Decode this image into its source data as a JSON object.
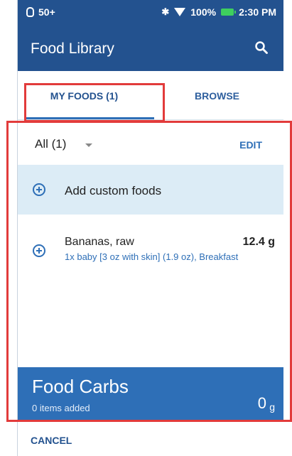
{
  "statusbar": {
    "alarm_text": "50+",
    "battery": "100%",
    "time": "2:30 PM"
  },
  "appbar": {
    "title": "Food Library"
  },
  "tabs": [
    {
      "label": "MY FOODS (1)",
      "active": true
    },
    {
      "label": "BROWSE",
      "active": false
    }
  ],
  "filter": {
    "selected": "All (1)",
    "edit_label": "EDIT"
  },
  "add_custom": {
    "label": "Add custom foods"
  },
  "foods": [
    {
      "name": "Bananas, raw",
      "carbs": "12.4 g",
      "detail": "1x baby [3 oz with skin] (1.9 oz), Breakfast"
    }
  ],
  "footer": {
    "title": "Food Carbs",
    "subtitle": "0 items added",
    "value": "0",
    "unit": "g"
  },
  "cancel_label": "CANCEL",
  "colors": {
    "appbar": "#23528f",
    "accent": "#2e6fb7",
    "highlight": "#e23b3b",
    "add_row_bg": "#dcecf6"
  }
}
